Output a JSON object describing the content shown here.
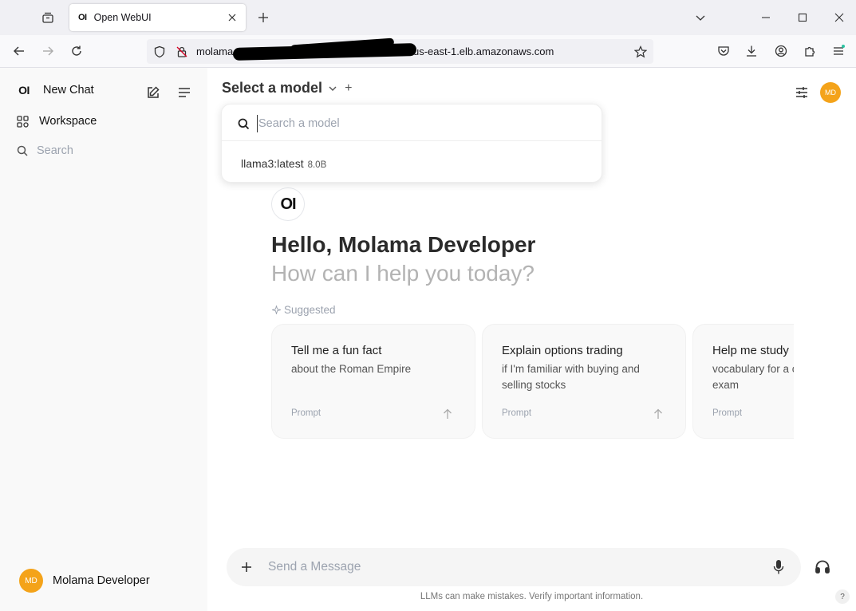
{
  "browser": {
    "tab_title": "Open WebUI",
    "tab_favicon": "OI",
    "url_prefix": "molama",
    "url_suffix": "us-east-1.elb.amazonaws.com"
  },
  "sidebar": {
    "logo": "OI",
    "new_chat_label": "New Chat",
    "workspace_label": "Workspace",
    "search_label": "Search",
    "user_initials": "MD",
    "user_name": "Molama Developer"
  },
  "header": {
    "model_select_label": "Select a model",
    "add_model_symbol": "+",
    "user_initials": "MD"
  },
  "model_dropdown": {
    "search_placeholder": "Search a model",
    "items": [
      {
        "name": "llama3:latest",
        "size": "8.0B"
      }
    ]
  },
  "hero": {
    "logo": "OI",
    "greeting": "Hello, Molama Developer",
    "subtitle": "How can I help you today?",
    "suggested_label": "Suggested"
  },
  "suggestions": [
    {
      "title": "Tell me a fun fact",
      "subtitle": "about the Roman Empire",
      "prompt_label": "Prompt"
    },
    {
      "title": "Explain options trading",
      "subtitle": "if I'm familiar with buying and selling stocks",
      "prompt_label": "Prompt"
    },
    {
      "title": "Help me study",
      "subtitle": "vocabulary for a college entrance exam",
      "prompt_label": "Prompt"
    }
  ],
  "composer": {
    "placeholder": "Send a Message"
  },
  "footer": {
    "disclaimer": "LLMs can make mistakes. Verify important information.",
    "help_label": "?"
  }
}
